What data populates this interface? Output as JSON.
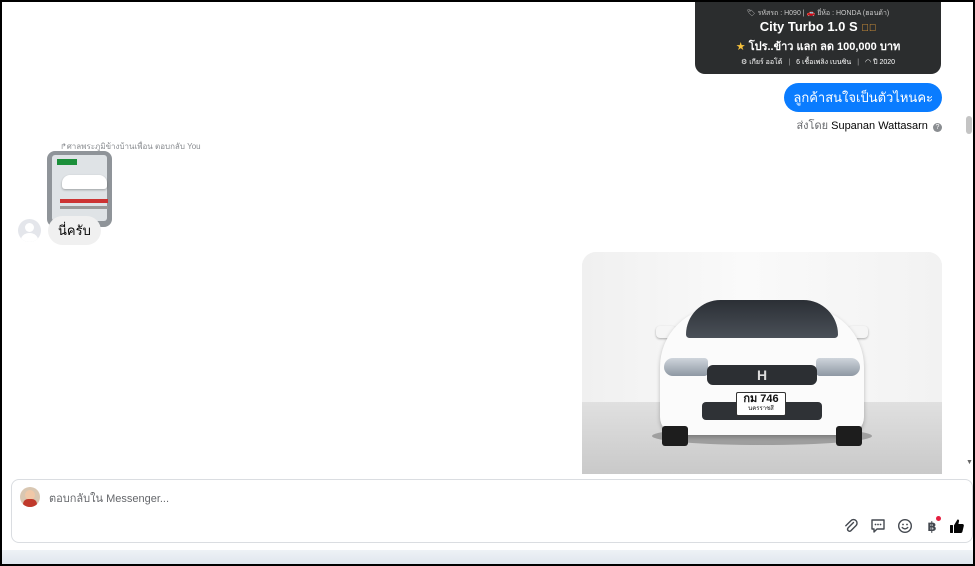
{
  "product_card": {
    "meta": "🏷 รหัสรถ : H090 | 🚗 ยี่ห้อ : HONDA (ฮอนด้า)",
    "title": "City Turbo 1.0 S",
    "promo": "โปร..ข้าว แลก ลด 100,000 บาท",
    "specs": [
      "⚙ เกียร์ ออโต้",
      "6 เชื้อเพลิง เบนซิน",
      "◠ ปี 2020"
    ]
  },
  "messages": {
    "outgoing_text": "ลูกค้าสนใจเป็นตัวไหนคะ",
    "sent_by_prefix": "ส่งโดย",
    "sent_by_name": "Supanan Wattasarn",
    "reply_header": "↱ศาลพระภูมิข้างบ้านเพื่อน ตอบกลับ You",
    "incoming_text": "นี่ครับ"
  },
  "photo": {
    "plate_main": "กม 746",
    "plate_sub": "นครราชสี"
  },
  "composer": {
    "placeholder": "ตอบกลับใน Messenger...",
    "icons": [
      "attach-icon",
      "sticker-icon",
      "emoji-icon",
      "baht-icon",
      "like-icon"
    ],
    "baht_symbol": "฿"
  },
  "colors": {
    "accent": "#0a7cff",
    "card_bg": "#2b2d2e",
    "notification_dot": "#e41e3f"
  }
}
